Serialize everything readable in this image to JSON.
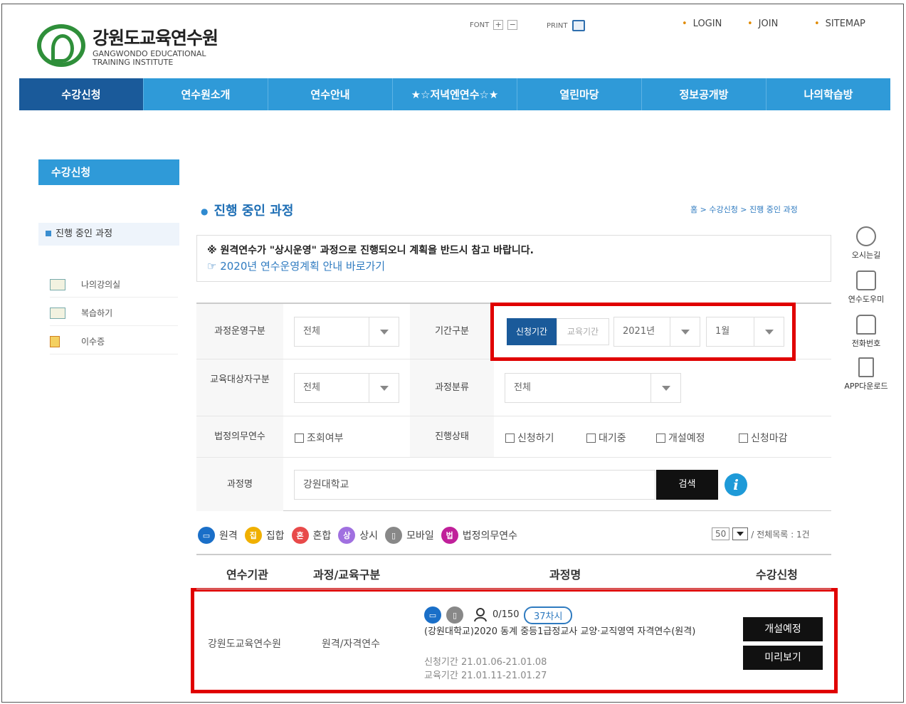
{
  "header": {
    "logo_kr": "강원도교육연수원",
    "logo_en1": "GANGWONDO EDUCATIONAL",
    "logo_en2": "TRAINING INSTITUTE",
    "font_label": "FONT",
    "font_plus": "+",
    "font_minus": "−",
    "print_label": "PRINT",
    "login": "LOGIN",
    "join": "JOIN",
    "sitemap": "SITEMAP"
  },
  "nav": [
    "수강신청",
    "연수원소개",
    "연수안내",
    "★☆저녁엔연수☆★",
    "열린마당",
    "정보공개방",
    "나의학습방"
  ],
  "sidebar": {
    "title": "수강신청",
    "current": "진행 중인 과정",
    "links": [
      "나의강의실",
      "복습하기",
      "이수증"
    ]
  },
  "content": {
    "title": "진행 중인 과정",
    "breadcrumb": "홈 > 수강신청 > 진행 중인 과정",
    "notice_1": "※ 원격연수가 \"상시운영\" 과정으로 진행되오니 계획을 반드시 참고 바랍니다.",
    "notice_2": "☞ 2020년 연수운영계획 안내 바로가기"
  },
  "form": {
    "op_label": "과정운영구분",
    "op_value": "전체",
    "period_label": "기간구분",
    "period_on": "신청기간",
    "period_off": "교육기간",
    "year": "2021년",
    "month": "1월",
    "target_label": "교육대상자구분",
    "target_value": "전체",
    "category_label": "과정분류",
    "category_value": "전체",
    "legal_label": "법정의무연수",
    "legal_check": "조회여부",
    "status_label": "진행상태",
    "status_options": [
      "신청하기",
      "대기중",
      "개설예정",
      "신청마감"
    ],
    "name_label": "과정명",
    "name_value": "강원대학교",
    "search_button": "검색",
    "info_icon": "i"
  },
  "legend": {
    "items": [
      {
        "label": "원격",
        "color": "#1a6fc8",
        "glyph": "▭"
      },
      {
        "label": "집합",
        "color": "#f0b000",
        "glyph": "집"
      },
      {
        "label": "혼합",
        "color": "#e84a4a",
        "glyph": "혼"
      },
      {
        "label": "상시",
        "color": "#a070e0",
        "glyph": "상"
      },
      {
        "label": "모바일",
        "color": "#888888",
        "glyph": "▯"
      },
      {
        "label": "법정의무연수",
        "color": "#c0209a",
        "glyph": "법"
      }
    ],
    "per_page": "50",
    "total": "/ 전체목록 : 1건"
  },
  "table": {
    "headers": [
      "연수기관",
      "과정/교육구분",
      "과정명",
      "수강신청"
    ],
    "row": {
      "org": "강원도교육연수원",
      "type": "원격/자격연수",
      "capacity": "0/150",
      "hours": "37차시",
      "title": "(강원대학교)2020 동계 중등1급정교사 교양·교직영역 자격연수(원격)",
      "apply_period": "신청기간 21.01.06-21.01.08",
      "edu_period": "교육기간 21.01.11-21.01.27",
      "status_button": "개설예정",
      "preview_button": "미리보기"
    }
  },
  "quick": [
    "오시는길",
    "연수도우미",
    "전화번호",
    "APP다운로드"
  ]
}
